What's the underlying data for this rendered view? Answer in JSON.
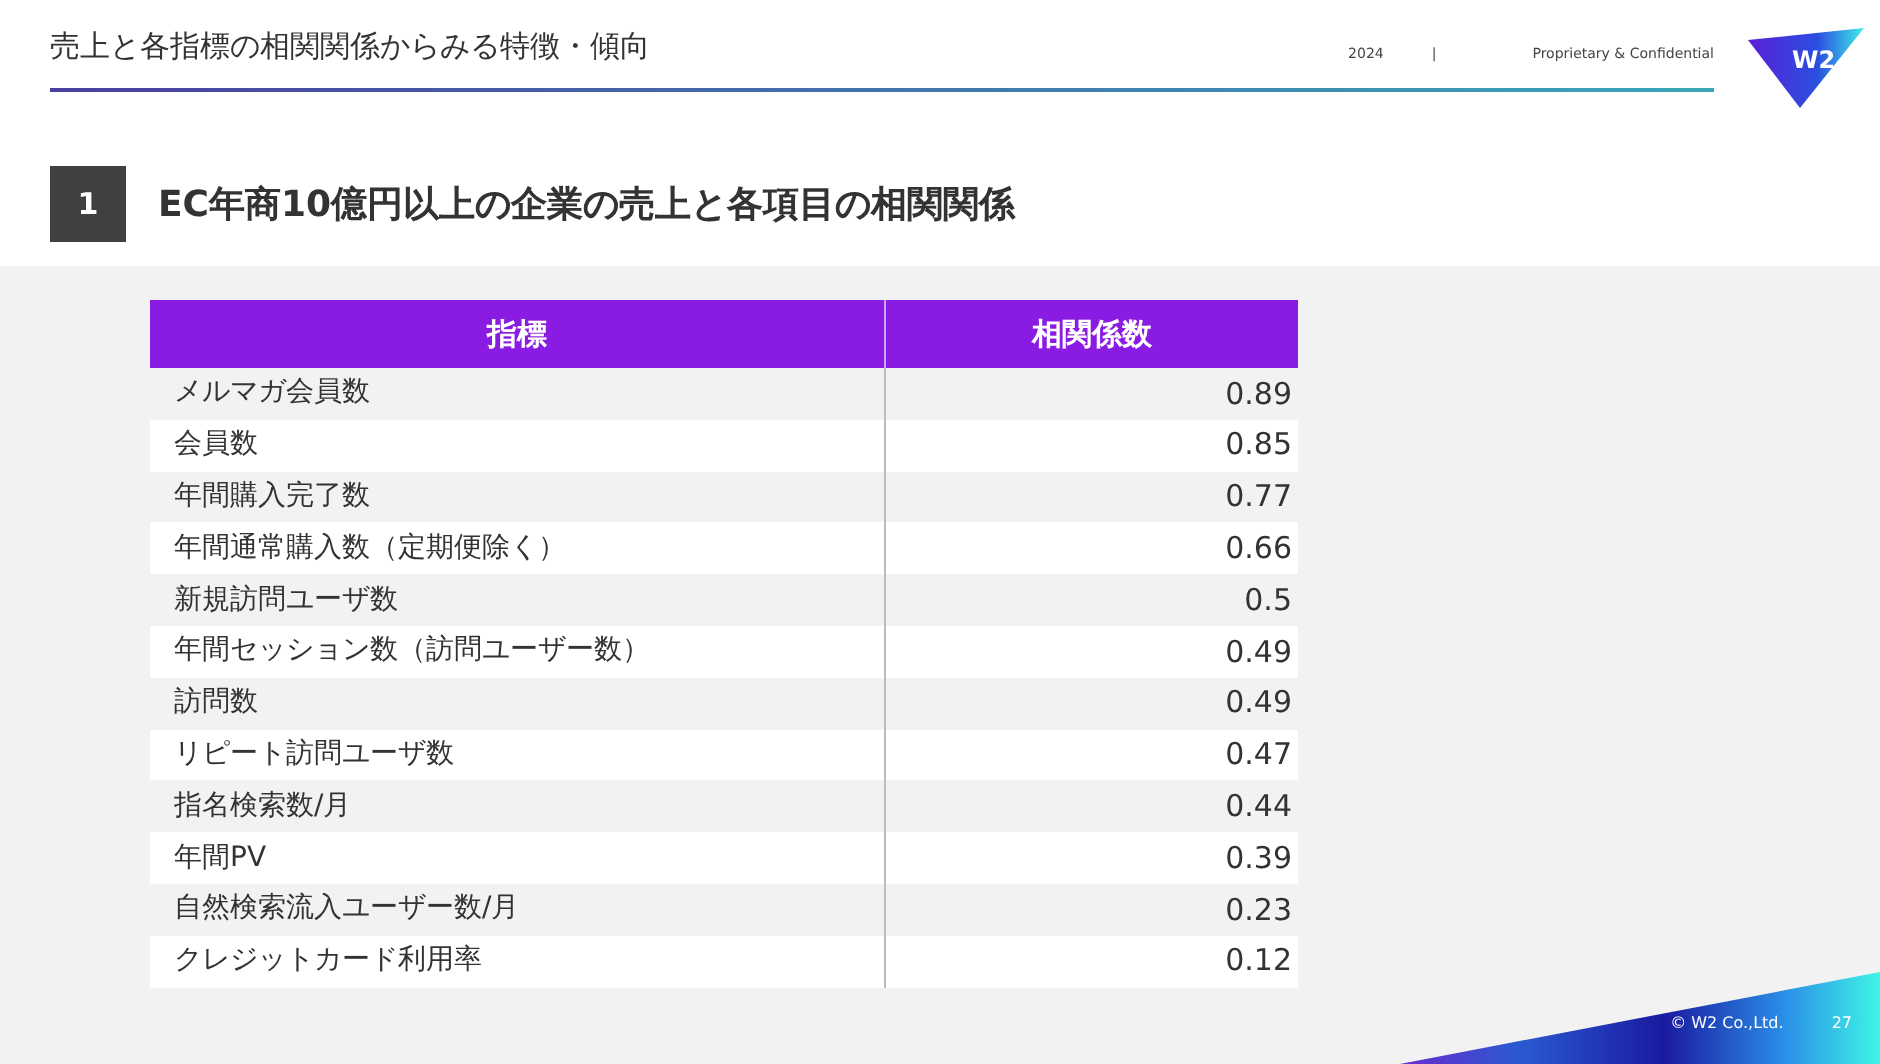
{
  "header": {
    "title": "売上と各指標の相関関係からみる特徴・傾向",
    "year": "2024",
    "separator": "|",
    "confidentiality": "Proprietary & Confidential",
    "logo": "W2"
  },
  "section": {
    "number": "1",
    "title": "EC年商10億円以上の企業の売上と各項目の相関関係"
  },
  "table": {
    "columns": [
      "指標",
      "相関係数"
    ],
    "rows": [
      {
        "metric": "メルマガ会員数",
        "value": "0.89"
      },
      {
        "metric": "会員数",
        "value": "0.85"
      },
      {
        "metric": "年間購入完了数",
        "value": "0.77"
      },
      {
        "metric": "年間通常購入数（定期便除く）",
        "value": "0.66"
      },
      {
        "metric": "新規訪問ユーザ数",
        "value": "0.5"
      },
      {
        "metric": "年間セッション数（訪問ユーザー数）",
        "value": "0.49"
      },
      {
        "metric": "訪問数",
        "value": "0.49"
      },
      {
        "metric": "リピート訪問ユーザ数",
        "value": "0.47"
      },
      {
        "metric": "指名検索数/月",
        "value": "0.44"
      },
      {
        "metric": "年間PV",
        "value": "0.39"
      },
      {
        "metric": "自然検索流入ユーザー数/月",
        "value": "0.23"
      },
      {
        "metric": "クレジットカード利用率",
        "value": "0.12"
      }
    ]
  },
  "footer": {
    "copyright": "© W2 Co.,Ltd.",
    "page": "27"
  }
}
